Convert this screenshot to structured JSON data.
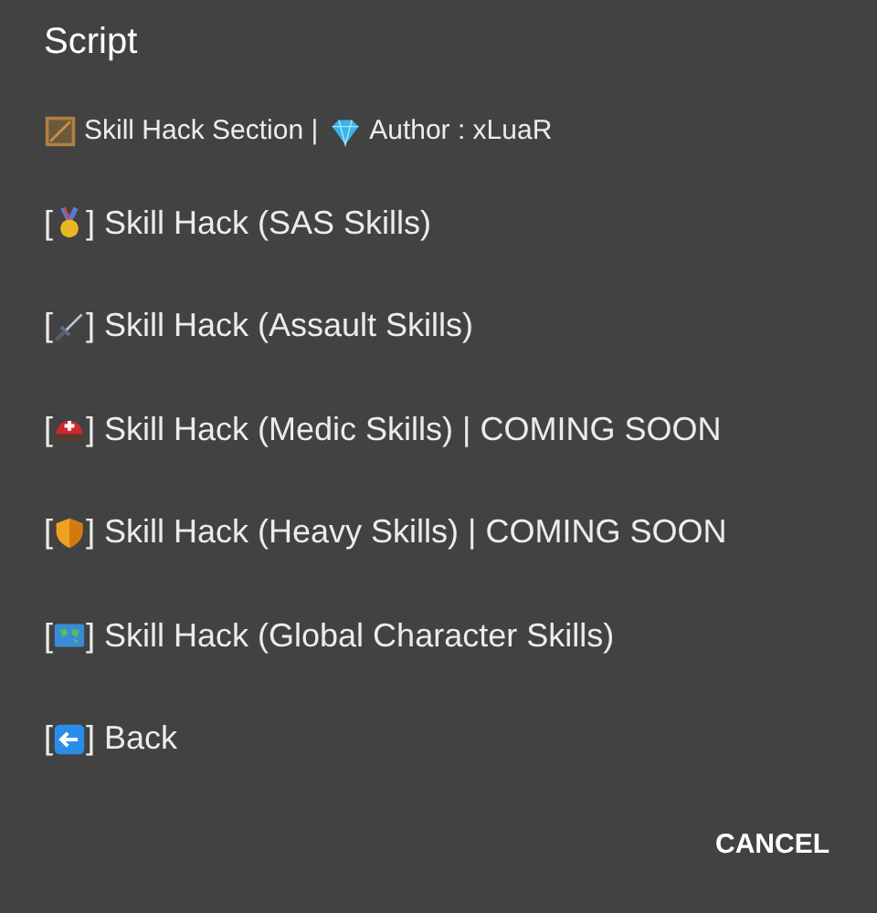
{
  "dialog": {
    "title": "Script",
    "header": [
      {
        "kind": "frame",
        "text": "Skill Hack Section |"
      },
      {
        "kind": "diamond",
        "text": "Author : xLuaR"
      }
    ],
    "items": [
      {
        "kind": "medal",
        "open": "[",
        "label": "] Skill Hack (SAS Skills)"
      },
      {
        "kind": "dagger",
        "open": "[",
        "label": "] Skill Hack (Assault Skills)"
      },
      {
        "kind": "helmet",
        "open": "[",
        "label": "] Skill Hack (Medic Skills) | COMING SOON"
      },
      {
        "kind": "shield",
        "open": "[",
        "label": "] Skill Hack (Heavy Skills) | COMING SOON"
      },
      {
        "kind": "map",
        "open": "[",
        "label": "] Skill Hack (Global Character Skills)"
      },
      {
        "kind": "back",
        "open": "[",
        "label": "] Back"
      }
    ],
    "buttons": [
      "CANCEL"
    ]
  }
}
